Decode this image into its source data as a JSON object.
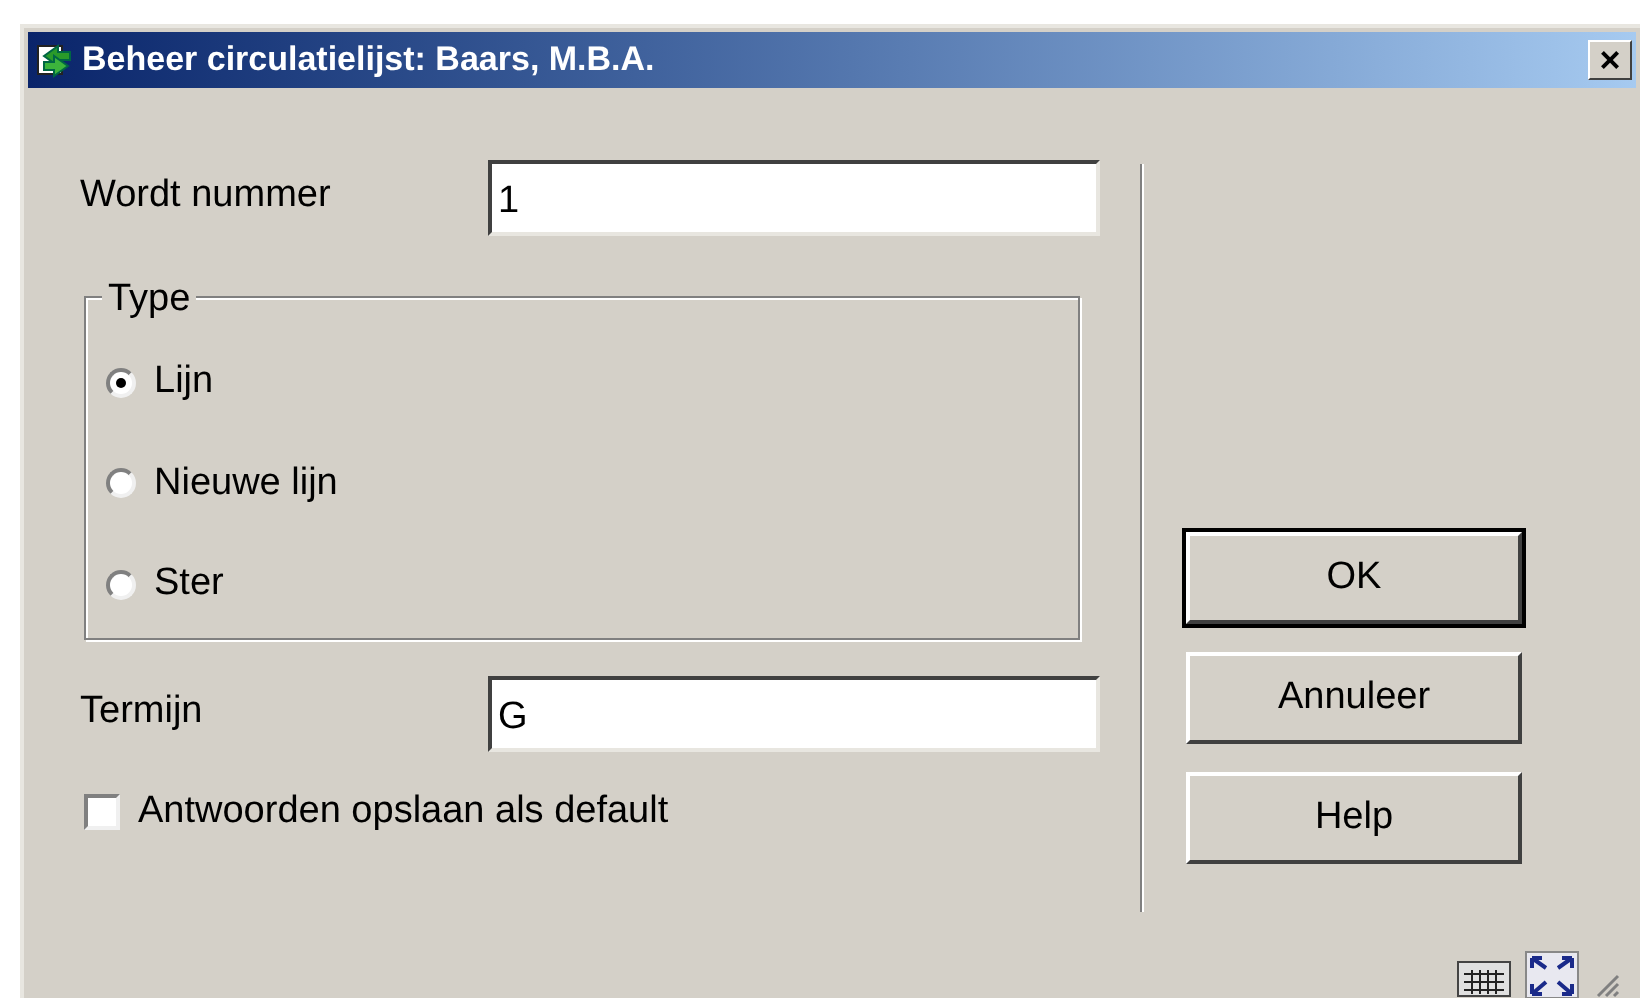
{
  "window": {
    "title": "Beheer circulatielijst: Baars, M.B.A.",
    "close": "×"
  },
  "fields": [
    {
      "label": "Wordt nummer",
      "value": "1"
    }
  ],
  "type_group": {
    "legend": "Type",
    "options": [
      {
        "label": "Lijn",
        "selected": true
      },
      {
        "label": "Nieuwe lijn",
        "selected": false
      },
      {
        "label": "Ster",
        "selected": false
      }
    ]
  },
  "term_field": {
    "label": "Termijn",
    "value": "G"
  },
  "save_default": {
    "label": "Antwoorden opslaan als default",
    "checked": false
  },
  "buttons": [
    {
      "label": "OK",
      "default": true
    },
    {
      "label": "Annuleer",
      "default": false
    },
    {
      "label": "Help",
      "default": false
    }
  ]
}
